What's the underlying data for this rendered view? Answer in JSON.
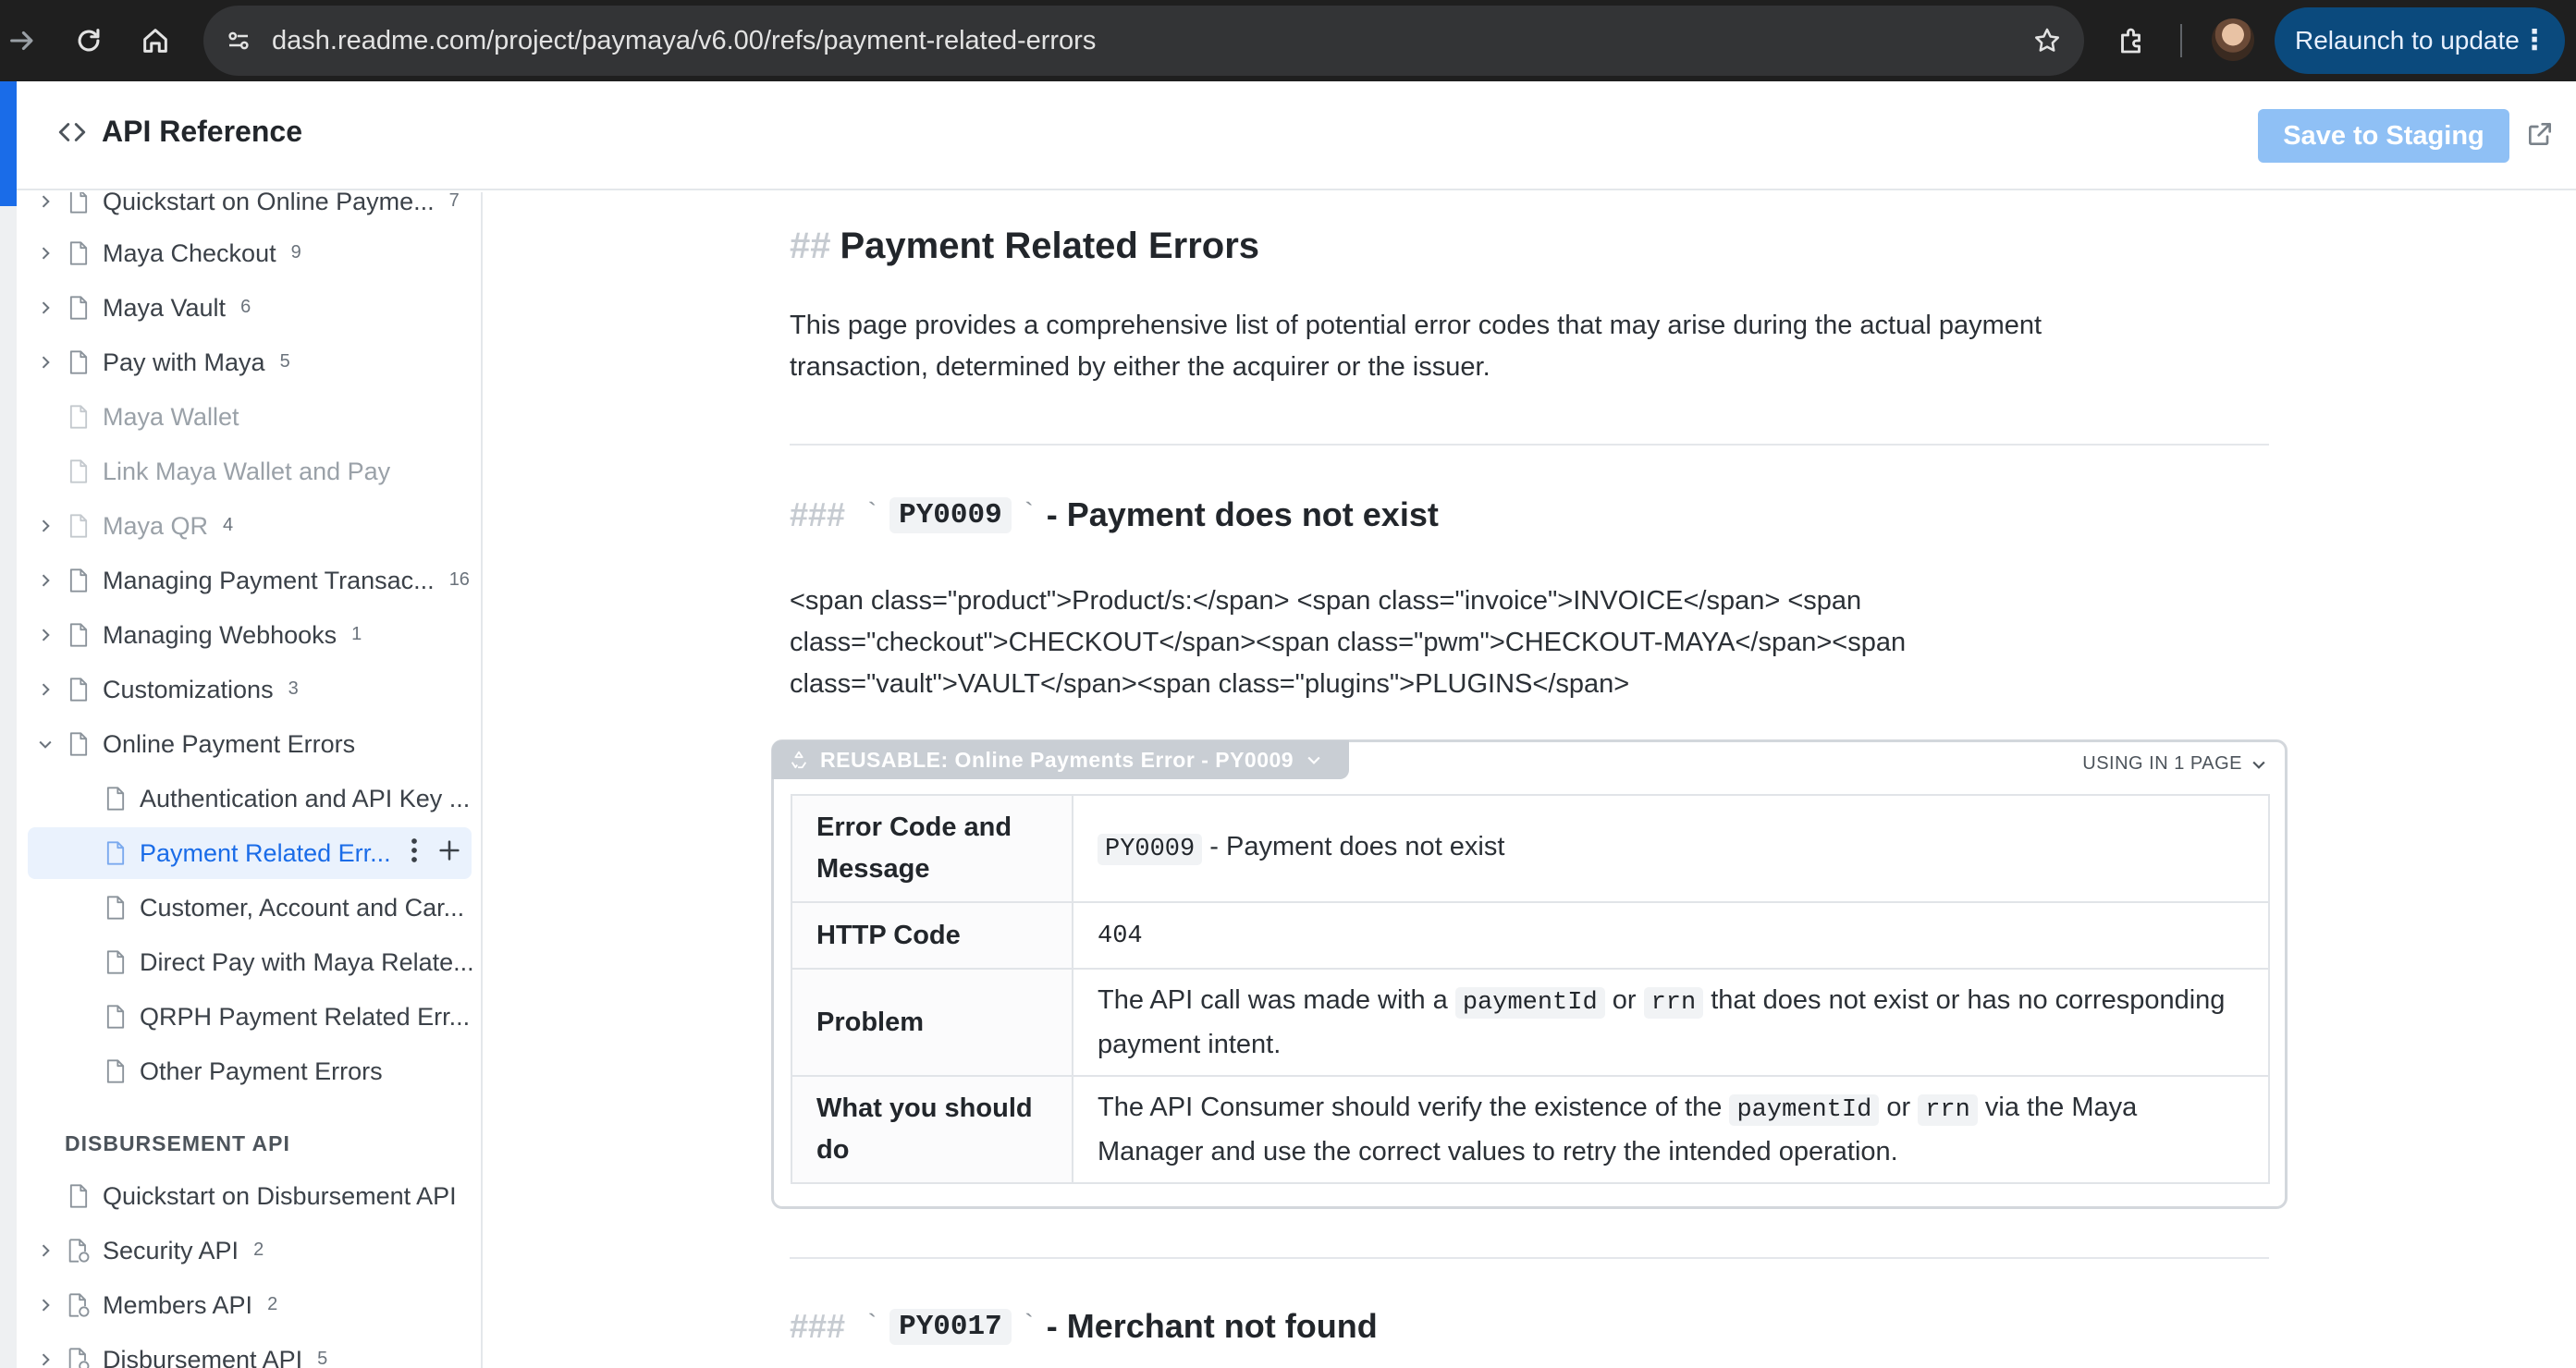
{
  "browser": {
    "url": "dash.readme.com/project/paymaya/v6.00/refs/payment-related-errors",
    "relaunch_label": "Relaunch to update",
    "relaunch_menu": "⋮"
  },
  "header": {
    "section_title": "API Reference",
    "save_label": "Save to Staging"
  },
  "sidebar": {
    "items": [
      {
        "label": "Quickstart on Online Payme...",
        "count": "7",
        "chevron": true,
        "muted": false
      },
      {
        "label": "Maya Checkout",
        "count": "9",
        "chevron": true,
        "muted": false
      },
      {
        "label": "Maya Vault",
        "count": "6",
        "chevron": true,
        "muted": false
      },
      {
        "label": "Pay with Maya",
        "count": "5",
        "chevron": true,
        "muted": false
      },
      {
        "label": "Maya Wallet",
        "count": "",
        "chevron": false,
        "muted": true
      },
      {
        "label": "Link Maya Wallet and Pay",
        "count": "",
        "chevron": false,
        "muted": true
      },
      {
        "label": "Maya QR",
        "count": "4",
        "chevron": true,
        "muted": true
      },
      {
        "label": "Managing Payment Transac...",
        "count": "16",
        "chevron": true,
        "muted": false
      },
      {
        "label": "Managing Webhooks",
        "count": "1",
        "chevron": true,
        "muted": false
      },
      {
        "label": "Customizations",
        "count": "3",
        "chevron": true,
        "muted": false
      },
      {
        "label": "Online Payment Errors",
        "count": "",
        "chevron": true,
        "muted": false
      },
      {
        "label": "Authentication and API Key ...",
        "count": "",
        "chevron": false,
        "muted": false
      },
      {
        "label": "Payment Related Err...",
        "count": "",
        "chevron": false,
        "muted": false
      },
      {
        "label": "Customer, Account and Car...",
        "count": "",
        "chevron": false,
        "muted": false
      },
      {
        "label": "Direct Pay with Maya Relate...",
        "count": "",
        "chevron": false,
        "muted": false
      },
      {
        "label": "QRPH Payment Related Err...",
        "count": "",
        "chevron": false,
        "muted": false
      },
      {
        "label": "Other Payment Errors",
        "count": "",
        "chevron": false,
        "muted": false
      }
    ],
    "section_heading": "DISBURSEMENT API",
    "items2": [
      {
        "label": "Quickstart on Disbursement API",
        "count": "",
        "chevron": false
      },
      {
        "label": "Security API",
        "count": "2",
        "chevron": true
      },
      {
        "label": "Members API",
        "count": "2",
        "chevron": true
      },
      {
        "label": "Disbursement API",
        "count": "5",
        "chevron": true
      }
    ]
  },
  "main": {
    "h2_hash": "##",
    "h2": "Payment Related Errors",
    "intro_line1": "This page provides a comprehensive list of potential error codes that may arise during the actual payment",
    "intro_line2": "transaction, determined by either the acquirer or the issuer.",
    "h3_hash": "###",
    "tick": "`",
    "error1": {
      "code": "PY0009",
      "title": "- Payment does not exist",
      "span_line1": "<span class=\"product\">Product/s:</span> <span class=\"invoice\">INVOICE</span> <span",
      "span_line2": "class=\"checkout\">CHECKOUT</span><span class=\"pwm\">CHECKOUT-MAYA</span><span",
      "span_line3": "class=\"vault\">VAULT</span><span class=\"plugins\">PLUGINS</span>",
      "reusable_label": "REUSABLE: Online Payments Error - PY0009",
      "using_label": "USING IN 1 PAGE",
      "rows": {
        "r1_key": "Error Code and Message",
        "r1_code": "PY0009",
        "r1_text": " - Payment does not exist",
        "r2_key": "HTTP Code",
        "r2_code": "404",
        "r3_key": "Problem",
        "r3_a": "The API call was made with a ",
        "r3_c1": "paymentId",
        "r3_b": " or ",
        "r3_c2": "rrn",
        "r3_c": " that does not exist or has no corresponding payment intent.",
        "r4_key": "What you should do",
        "r4_a": "The API Consumer should verify the existence of the ",
        "r4_c1": "paymentId",
        "r4_b": " or ",
        "r4_c2": "rrn",
        "r4_c": " via the Maya Manager and use the correct values to retry the intended operation."
      }
    },
    "error2": {
      "code": "PY0017",
      "title": "- Merchant not found"
    }
  },
  "colors": {
    "accent": "#1a6ce8",
    "save_button_disabled": "#8fc0f5",
    "relaunch_bg": "#0b4a7d"
  }
}
